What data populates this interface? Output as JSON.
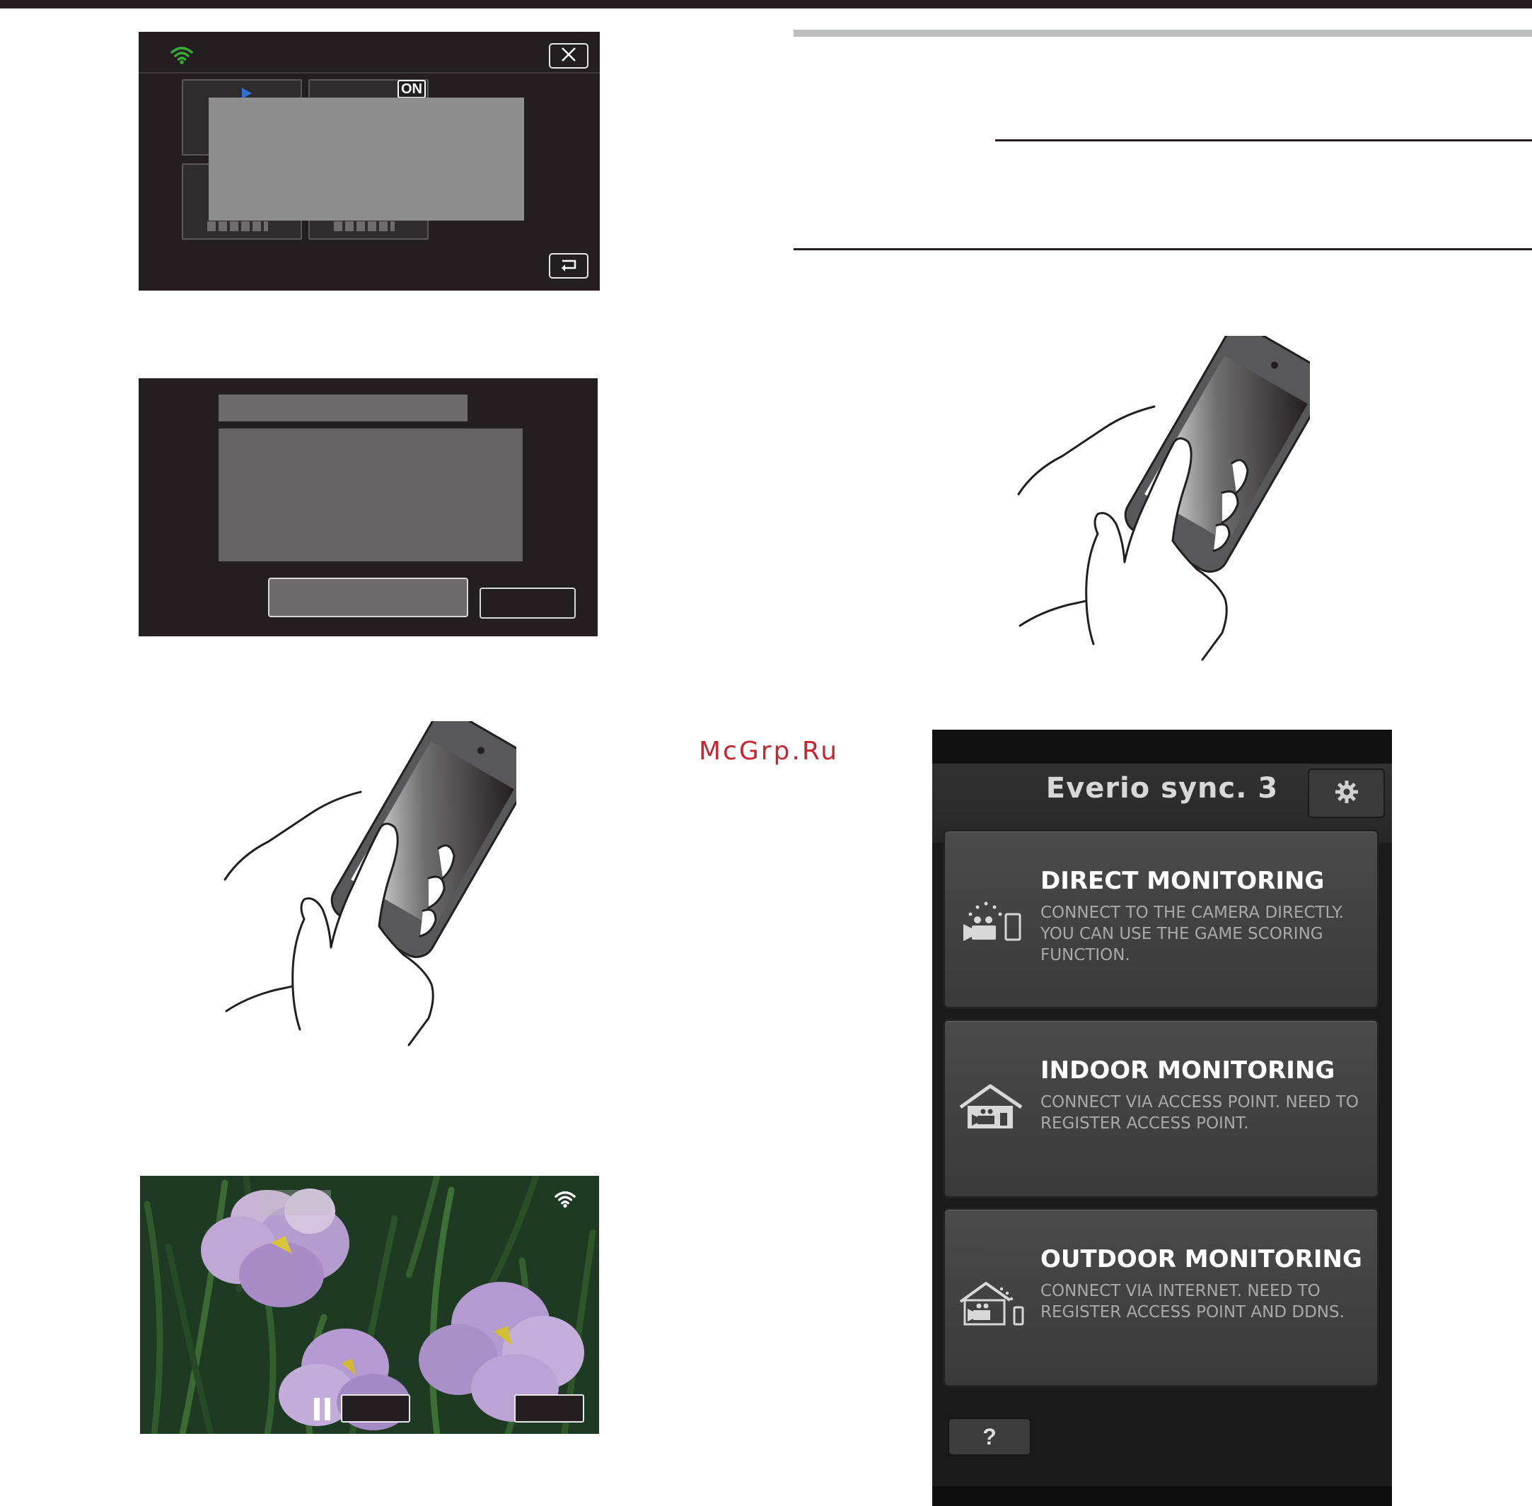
{
  "camera_screen_1": {
    "on_badge": "ON",
    "icons": [
      "wifi-icon",
      "close-icon",
      "back-icon"
    ]
  },
  "camera_screen_3": {
    "icons": [
      "wifi-icon",
      "pause-icon"
    ]
  },
  "watermark": "McGrp.Ru",
  "app": {
    "title": "Everio sync. 3",
    "modes": [
      {
        "title": "DIRECT MONITORING",
        "description": "CONNECT TO THE CAMERA DIRECTLY. YOU CAN USE THE GAME SCORING FUNCTION.",
        "icon": "direct-camera-phone-icon"
      },
      {
        "title": "INDOOR MONITORING",
        "description": "CONNECT VIA ACCESS POINT. NEED TO REGISTER ACCESS POINT.",
        "icon": "indoor-house-icon"
      },
      {
        "title": "OUTDOOR MONITORING",
        "description": "CONNECT VIA INTERNET. NEED TO REGISTER ACCESS POINT AND DDNS.",
        "icon": "outdoor-house-icon"
      }
    ],
    "help_label": "?",
    "settings_icon": "gear-icon"
  },
  "colors": {
    "camera_bg": "#231f20",
    "wifi_green": "#3aa935",
    "watermark_red": "#c8262f",
    "app_bg": "#1a1a1a"
  }
}
